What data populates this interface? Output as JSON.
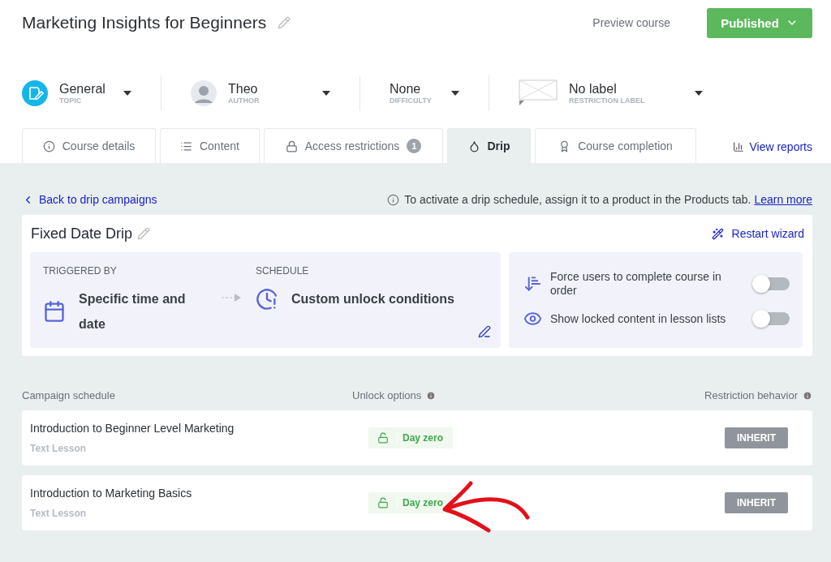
{
  "header": {
    "title": "Marketing Insights for Beginners",
    "preview": "Preview course",
    "publish": "Published"
  },
  "meta": [
    {
      "kind": "topic",
      "value": "General",
      "label": "TOPIC"
    },
    {
      "kind": "author",
      "value": "Theo",
      "label": "AUTHOR"
    },
    {
      "kind": "plain",
      "value": "None",
      "label": "DIFFICULTY"
    },
    {
      "kind": "restriction",
      "value": "No label",
      "label": "RESTRICTION LABEL"
    }
  ],
  "tabs": [
    {
      "kind": "info",
      "label": "Course details",
      "selected": false
    },
    {
      "kind": "list",
      "label": "Content",
      "selected": false
    },
    {
      "kind": "lock",
      "label": "Access restrictions",
      "badge": "1",
      "selected": false
    },
    {
      "kind": "drop",
      "label": "Drip",
      "selected": true
    },
    {
      "kind": "award",
      "label": "Course completion",
      "selected": false
    }
  ],
  "view_reports": "View reports",
  "back_link": "Back to drip campaigns",
  "notice": {
    "text": "To activate a drip schedule, assign it to a product in the Products tab.",
    "link": "Learn more"
  },
  "drip": {
    "title": "Fixed Date Drip",
    "restart": "Restart wizard",
    "trigger": {
      "heading": "TRIGGERED BY",
      "value": "Specific time and date"
    },
    "schedule": {
      "heading": "SCHEDULE",
      "value": "Custom unlock conditions"
    },
    "options": [
      {
        "kind": "order",
        "label": "Force users to complete course in order",
        "on": false
      },
      {
        "kind": "eye",
        "label": "Show locked content in lesson lists",
        "on": false
      }
    ]
  },
  "table": {
    "columns": [
      "Campaign schedule",
      "Unlock options",
      "Restriction behavior"
    ],
    "rows": [
      {
        "title": "Introduction to Beginner Level Marketing",
        "type": "Text Lesson",
        "unlock": "Day zero",
        "behavior": "INHERIT"
      },
      {
        "title": "Introduction to Marketing Basics",
        "type": "Text Lesson",
        "unlock": "Day zero",
        "behavior": "INHERIT"
      }
    ]
  }
}
